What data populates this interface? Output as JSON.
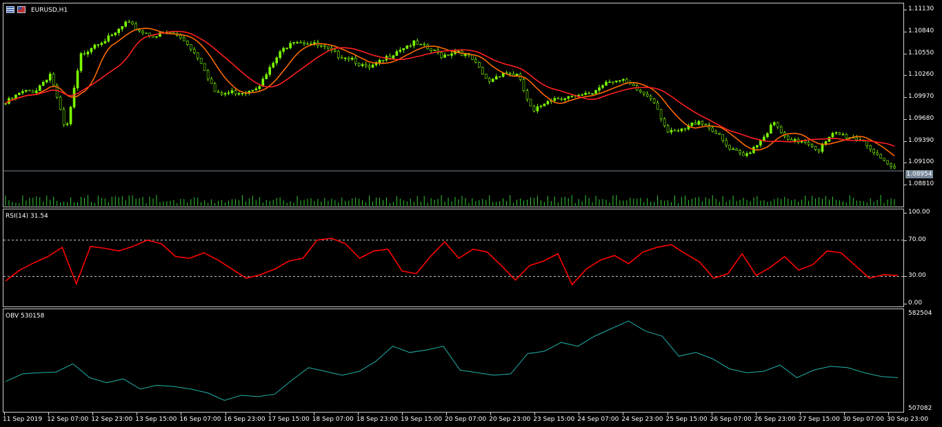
{
  "window": {
    "symbol_title": "EURUSD,H1"
  },
  "price_axis": {
    "labels": [
      "1.11130",
      "1.10840",
      "1.10550",
      "1.10260",
      "1.09970",
      "1.09680",
      "1.09390",
      "1.09100",
      "1.08810"
    ],
    "current_price": "1.08954"
  },
  "rsi": {
    "title": "RSI(14) 31.54",
    "levels": [
      "100.00",
      "70.00",
      "30.00",
      "0.00"
    ]
  },
  "obv": {
    "title": "OBV 530158",
    "max_label": "582504",
    "min_label": "507082"
  },
  "time_axis": {
    "labels": [
      "11 Sep 2019",
      "12 Sep 07:00",
      "12 Sep 23:00",
      "13 Sep 15:00",
      "16 Sep 07:00",
      "16 Sep 23:00",
      "17 Sep 15:00",
      "18 Sep 07:00",
      "18 Sep 23:00",
      "19 Sep 15:00",
      "20 Sep 07:00",
      "20 Sep 23:00",
      "23 Sep 15:00",
      "24 Sep 07:00",
      "24 Sep 23:00",
      "25 Sep 15:00",
      "26 Sep 07:00",
      "26 Sep 23:00",
      "27 Sep 15:00",
      "30 Sep 07:00",
      "30 Sep 23:00"
    ]
  },
  "colors": {
    "background": "#000000",
    "candles": "#7CFC00",
    "ma_fast": "#FF6A00",
    "ma_slow": "#FF2020",
    "rsi_line": "#FF0000",
    "obv_line": "#20B2AA",
    "volume": "#32CD32",
    "grid_border": "#CFCFCF"
  },
  "chart_data": [
    {
      "type": "line",
      "title": "EURUSD,H1",
      "series": [
        {
          "values": [
            1.0987,
            1.1001,
            1.1005,
            1.1028,
            1.0946,
            1.1052,
            1.107,
            1.1076,
            1.1096,
            1.1085,
            1.1079,
            1.1083,
            1.1071,
            1.1044,
            1.0998,
            1.1002,
            1.1004,
            1.1015,
            1.1049,
            1.1074,
            1.107,
            1.1063,
            1.1053,
            1.1049,
            1.1033,
            1.1044,
            1.106,
            1.1069,
            1.1061,
            1.1052,
            1.106,
            1.1046,
            1.1016,
            1.103,
            1.1025,
            1.0973,
            1.0993,
            1.0996,
            1.0995,
            1.1002,
            1.102,
            1.1016,
            1.1004,
            1.0994,
            1.0946,
            1.095,
            1.0965,
            1.0951,
            1.0925,
            1.0915,
            1.0935,
            1.096,
            1.0933,
            1.0938,
            1.0924,
            1.0946,
            1.0942,
            1.0937,
            1.091,
            1.0898
          ]
        }
      ],
      "ylim": [
        1.0875,
        1.112
      ]
    },
    {
      "type": "line",
      "title": "RSI(14) 31.54",
      "series": [
        {
          "values": [
            25,
            37,
            45,
            52,
            62,
            22,
            63,
            61,
            58,
            63,
            70,
            66,
            52,
            50,
            56,
            48,
            38,
            28,
            32,
            38,
            47,
            50,
            70,
            72,
            66,
            50,
            58,
            60,
            36,
            33,
            52,
            68,
            50,
            60,
            57,
            42,
            26,
            42,
            47,
            55,
            21,
            38,
            48,
            53,
            44,
            57,
            62,
            65,
            55,
            46,
            28,
            33,
            55,
            31,
            40,
            52,
            37,
            43,
            58,
            56,
            42,
            28,
            32,
            31
          ]
        }
      ],
      "ylim": [
        0,
        100
      ]
    },
    {
      "type": "line",
      "title": "OBV 530158",
      "series": [
        {
          "values": [
            529000,
            535000,
            536000,
            536500,
            543000,
            532000,
            528000,
            531000,
            523000,
            526000,
            525000,
            523000,
            520000,
            514000,
            518000,
            517000,
            519000,
            530000,
            540000,
            537000,
            534000,
            537000,
            545000,
            557000,
            552000,
            554000,
            557000,
            538000,
            536000,
            534000,
            535000,
            551000,
            553000,
            560000,
            557000,
            565000,
            571000,
            577000,
            569000,
            565000,
            549000,
            552000,
            547000,
            539000,
            536000,
            537000,
            542000,
            532000,
            538000,
            541000,
            540000,
            536000,
            533000,
            532000
          ]
        }
      ],
      "ylim": [
        507082,
        582504
      ]
    }
  ]
}
